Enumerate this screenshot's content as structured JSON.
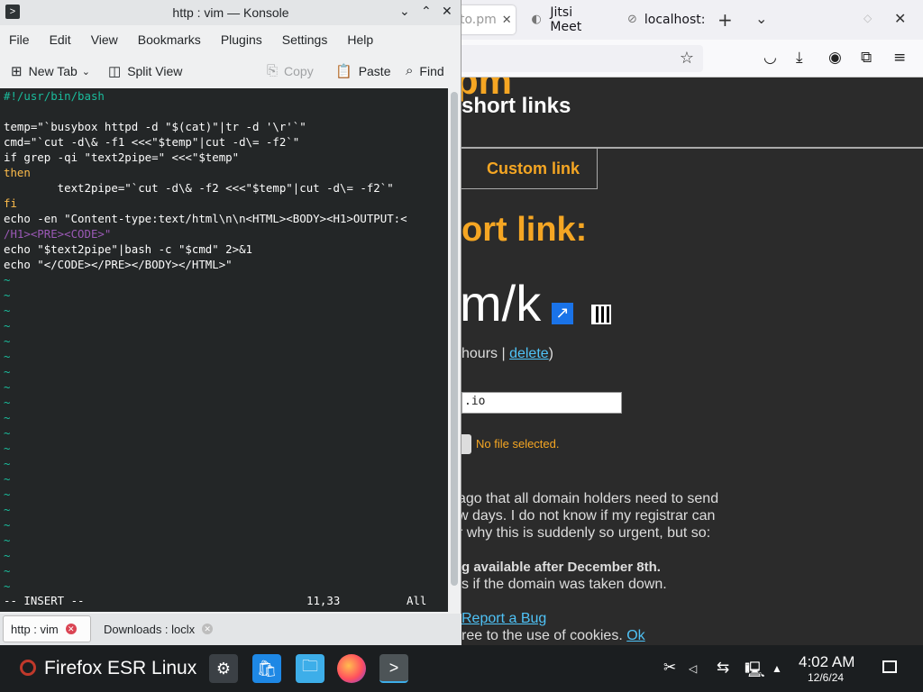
{
  "browser": {
    "tabs": [
      {
        "label": "to.pm",
        "icon": "page-icon"
      },
      {
        "label": "Jitsi Meet",
        "icon": "jitsi-icon"
      },
      {
        "label": "localhost:",
        "icon": "globe-icon"
      }
    ],
    "page": {
      "logo_text": "pm",
      "subtitle": "short links",
      "custom_link_tab": "Custom link",
      "heading": "ort link:",
      "short_link": "m/k",
      "expiry_prefix": "hours | ",
      "delete_link": "delete",
      "expiry_suffix": ")",
      "email_value": ".io",
      "no_file_text": "No file selected.",
      "notice_lines": [
        "ago that all domain holders need to send",
        "w days. I do not know if my registrar can",
        "r why this is suddenly so urgent, but so:"
      ],
      "notice_bold": "g available after December 8th.",
      "notice_tail": "s if the domain was taken down.",
      "report_bug": "Report a Bug",
      "cookie_text": "ree to the use of cookies. ",
      "cookie_ok": "Ok"
    }
  },
  "konsole": {
    "title": "http : vim — Konsole",
    "menu": [
      "File",
      "Edit",
      "View",
      "Bookmarks",
      "Plugins",
      "Settings",
      "Help"
    ],
    "toolbar": {
      "new_tab": "New Tab",
      "split_view": "Split View",
      "copy": "Copy",
      "paste": "Paste",
      "find": "Find"
    },
    "vim": {
      "lines": [
        "#!/usr/bin/bash",
        "",
        "temp=\"`busybox httpd -d \"$(cat)\"|tr -d '\\r'`\"",
        "cmd=\"`cut -d\\& -f1 <<<\"$temp\"|cut -d\\= -f2`\"",
        "if grep -qi \"text2pipe=\" <<<\"$temp\"",
        "then",
        "        text2pipe=\"`cut -d\\& -f2 <<<\"$temp\"|cut -d\\= -f2`\"",
        "fi",
        "echo -en \"Content-type:text/html\\n\\n<HTML><BODY><H1>OUTPUT:<",
        "/H1><PRE><CODE>\"",
        "echo \"$text2pipe\"|bash -c \"$cmd\" 2>&1",
        "echo \"</CODE></PRE></BODY></HTML>\""
      ],
      "tilde_count": 21,
      "mode": "-- INSERT --",
      "position": "11,33",
      "scroll": "All"
    },
    "tabs": [
      {
        "label": "http : vim"
      },
      {
        "label": "Downloads : loclx"
      }
    ]
  },
  "taskbar": {
    "active_app": "Firefox ESR Linux",
    "time": "4:02 AM",
    "date": "12/6/24"
  }
}
